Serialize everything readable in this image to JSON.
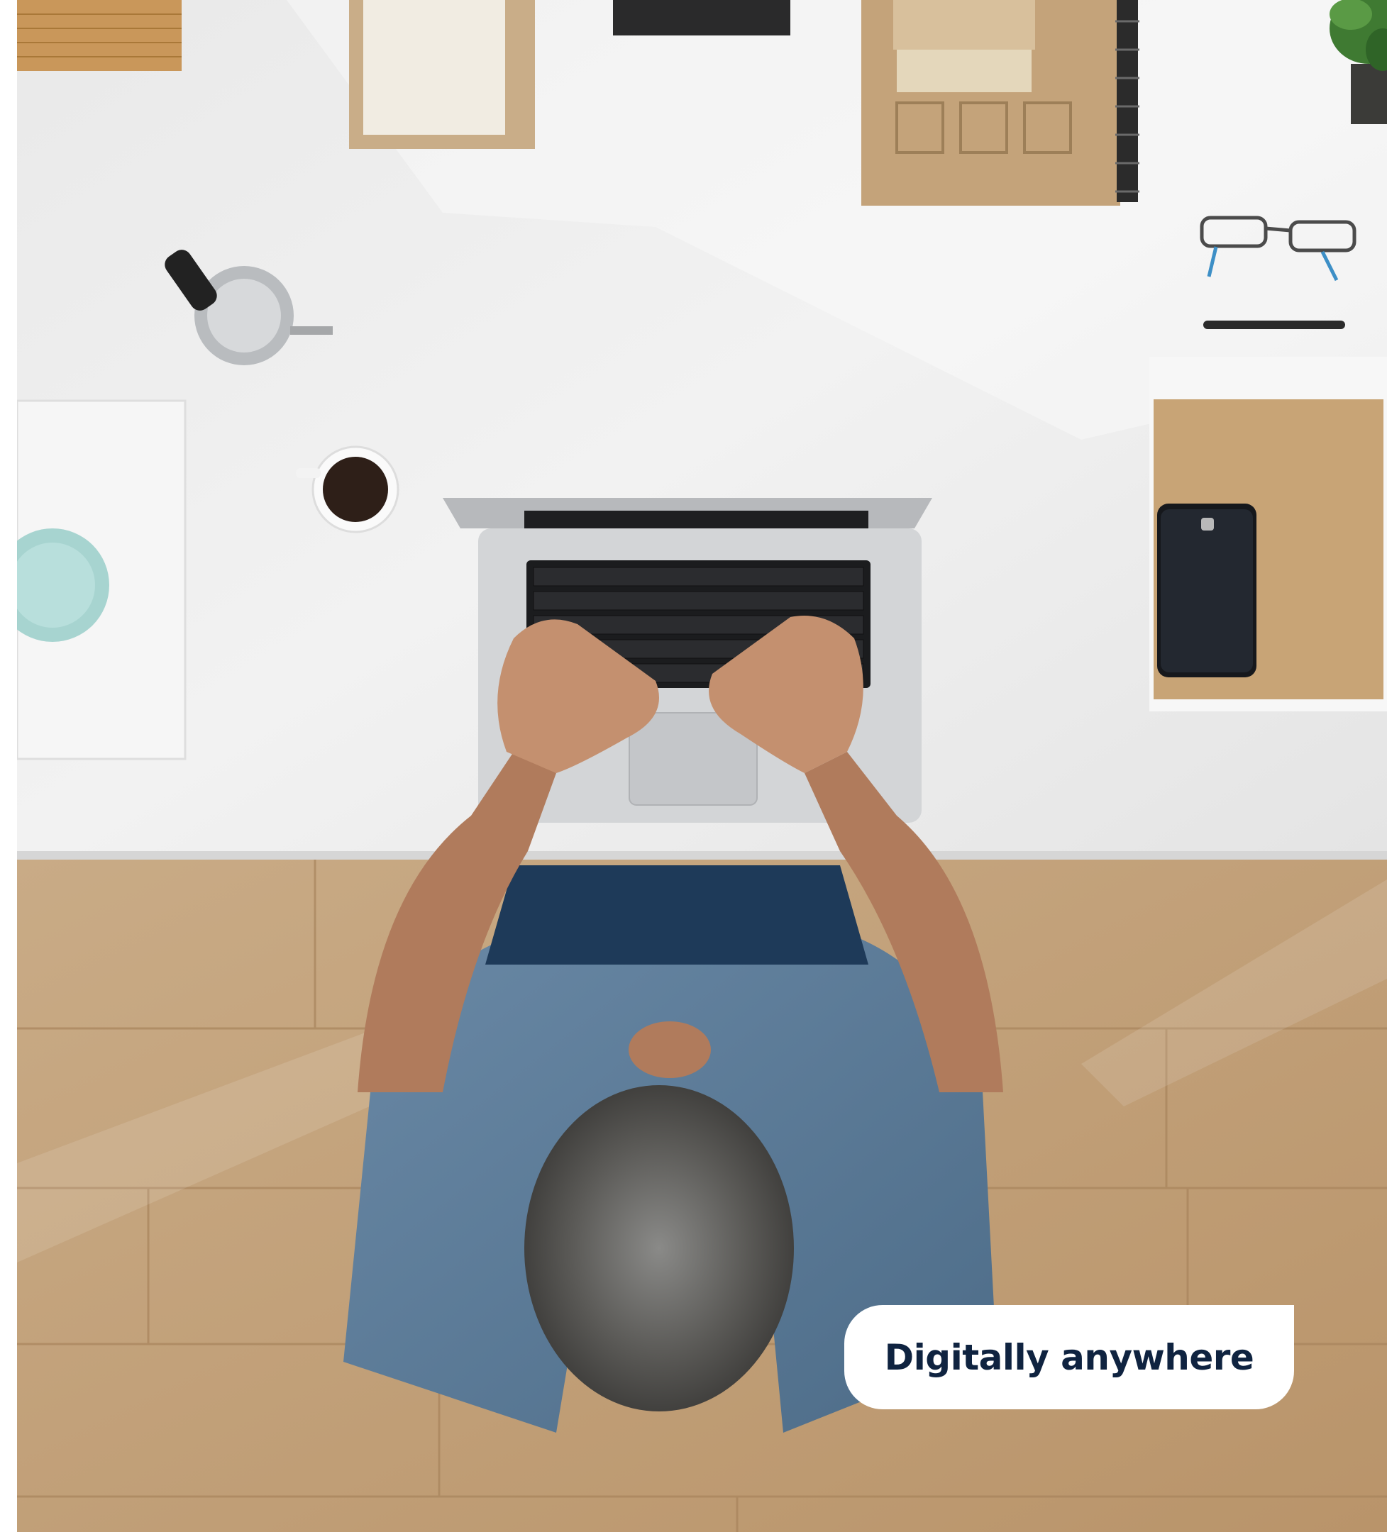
{
  "caption": {
    "text": "Digitally anywhere"
  },
  "colors": {
    "desk": "#efefef",
    "floor": "#c9a983",
    "shirt": "#5b7b99",
    "caption_bg": "#ffffff",
    "caption_text": "#0f2340"
  },
  "icons": {
    "laptop": "laptop-icon",
    "phone": "smartphone-icon",
    "coffee": "coffee-cup-icon",
    "glasses": "eyeglasses-icon",
    "pen": "pen-icon",
    "plant": "plant-icon",
    "press": "french-press-icon"
  }
}
